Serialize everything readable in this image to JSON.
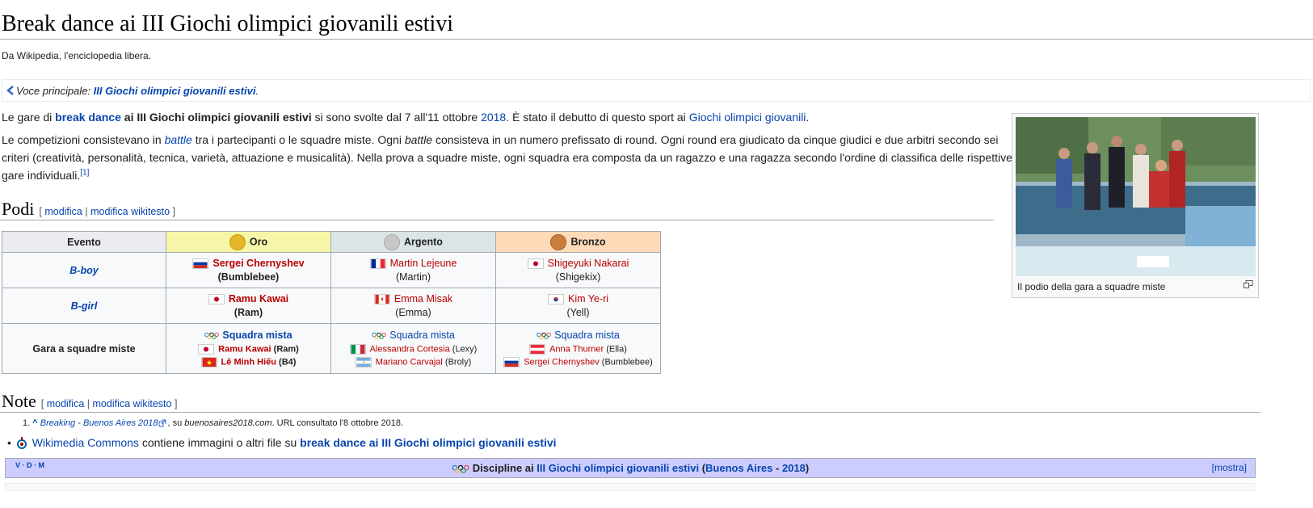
{
  "title": "Break dance ai III Giochi olimpici giovanili estivi",
  "tagline": "Da Wikipedia, l'enciclopedia libera.",
  "hatnote": {
    "prefix": "Voce principale: ",
    "link": "III Giochi olimpici giovanili estivi",
    "suffix": "."
  },
  "intro": {
    "t1": "Le gare di ",
    "l1": "break dance",
    "t2": " ai III Giochi olimpici giovanili estivi",
    "t3": " si sono svolte dal 7 all'11 ottobre ",
    "l2": "2018",
    "t4": ". È stato il debutto di questo sport ai ",
    "l3": "Giochi olimpici giovanili",
    "t5": "."
  },
  "para2": {
    "t1": "Le competizioni consistevano in ",
    "l1": "battle",
    "t2": " tra i partecipanti o le squadre miste. Ogni ",
    "i1": "battle",
    "t3": " consisteva in un numero prefissato di round. Ogni round era giudicato da cinque giudici e due arbitri secondo sei criteri (creatività, personalità, tecnica, varietà, attuazione e musicalità). Nella prova a squadre miste, ogni squadra era composta da un ragazzo e una ragazza secondo l'ordine di classifica delle rispettive gare individuali.",
    "ref": "[1]"
  },
  "podi": {
    "heading": "Podi",
    "edit_open": "[",
    "edit1": "modifica",
    "edit_sep": "|",
    "edit2": "modifica wikitesto",
    "edit_close": "]",
    "headers": {
      "evento": "Evento",
      "oro": "Oro",
      "argento": "Argento",
      "bronzo": "Bronzo"
    },
    "rows": [
      {
        "event": "B-boy",
        "gold": {
          "name": "Sergei Chernyshev",
          "nick": "(Bumblebee)"
        },
        "silver": {
          "name": "Martin Lejeune",
          "nick": "(Martin)"
        },
        "bronze": {
          "name": "Shigeyuki Nakarai",
          "nick": "(Shigekix)"
        }
      },
      {
        "event": "B-girl",
        "gold": {
          "name": "Ramu Kawai",
          "nick": "(Ram)"
        },
        "silver": {
          "name": "Emma Misak",
          "nick": "(Emma)"
        },
        "bronze": {
          "name": "Kim Ye-ri",
          "nick": "(Yell)"
        }
      },
      {
        "event": "Gara a squadre miste",
        "gold": {
          "team": "Squadra mista",
          "m1": "Ramu Kawai",
          "n1": " (Ram)",
          "m2": "Lê Minh Hiếu",
          "n2": " (B4)"
        },
        "silver": {
          "team": "Squadra mista",
          "m1": "Alessandra Cortesia",
          "n1": " (Lexy)",
          "m2": "Mariano Carvajal",
          "n2": " (Broly)"
        },
        "bronze": {
          "team": "Squadra mista",
          "m1": "Anna Thurner",
          "n1": " (Ella)",
          "m2": "Sergei Chernyshev",
          "n2": " (Bumblebee)"
        }
      }
    ]
  },
  "thumb": {
    "caption": "Il podio della gara a squadre miste"
  },
  "note": {
    "heading": "Note",
    "edit_open": "[",
    "edit1": "modifica",
    "edit_sep": "|",
    "edit2": "modifica wikitesto",
    "edit_close": "]",
    "ref_num": "1.",
    "ref_caret": "^",
    "ref_link": "Breaking - Buenos Aires 2018",
    "ref_on": ", su ",
    "ref_site": "buenosaires2018.com",
    "ref_access": ". URL consultato l'8 ottobre 2018."
  },
  "commons": {
    "link": "Wikimedia Commons",
    "text": " contiene immagini o altri file su ",
    "target": "break dance ai III Giochi olimpici giovanili estivi"
  },
  "navbox": {
    "vdm": "V · D · M",
    "t1": "Discipline ai ",
    "l1": "III Giochi olimpici giovanili estivi",
    "t2": " (",
    "l2": "Buenos Aires",
    "t3": " - ",
    "l3": "2018",
    "t4": ")",
    "show": "[mostra]"
  }
}
